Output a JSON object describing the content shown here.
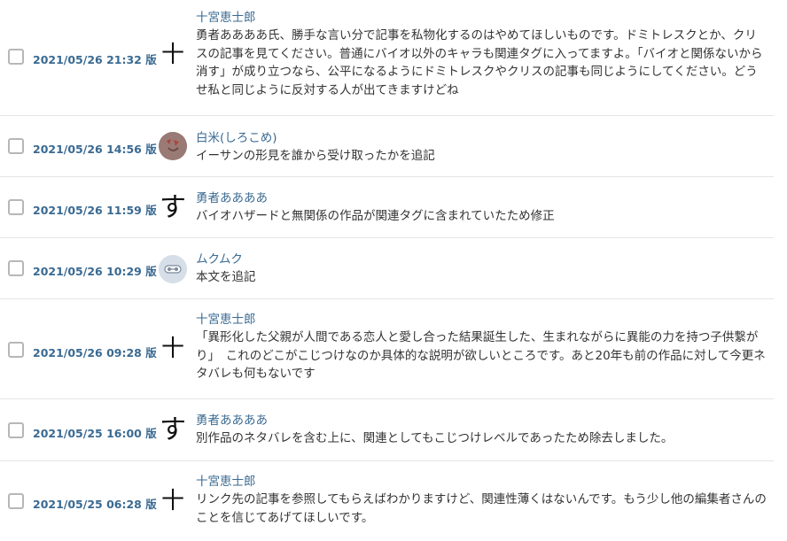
{
  "history": [
    {
      "version": "2021/05/26 21:32 版",
      "user": "十宮恵士郎",
      "avatar_icon": "ju-glyph-icon",
      "avatar_text": "十",
      "comment": "勇者ああああ氏、勝手な言い分で記事を私物化するのはやめてほしいものです。ドミトレスクとか、クリスの記事を見てください。普通にバイオ以外のキャラも関連タグに入ってますよ。「バイオと関係ないから消す」が成り立つなら、公平になるようにドミトレスクやクリスの記事も同じようにしてください。どうせ私と同じように反対する人が出てきますけどね"
    },
    {
      "version": "2021/05/26 14:56 版",
      "user": "白米(しろこめ)",
      "avatar_icon": "photo-avatar-icon",
      "avatar_text": "",
      "comment": "イーサンの形見を誰から受け取ったかを追記"
    },
    {
      "version": "2021/05/26 11:59 版",
      "user": "勇者ああああ",
      "avatar_icon": "su-glyph-icon",
      "avatar_text": "す",
      "comment": "バイオハザードと無関係の作品が関連タグに含まれていたため修正"
    },
    {
      "version": "2021/05/26 10:29 版",
      "user": "ムクムク",
      "avatar_icon": "robot-avatar-icon",
      "avatar_text": "",
      "comment": "本文を追記"
    },
    {
      "version": "2021/05/26 09:28 版",
      "user": "十宮恵士郎",
      "avatar_icon": "ju-glyph-icon",
      "avatar_text": "十",
      "comment": "「異形化した父親が人間である恋人と愛し合った結果誕生した、生まれながらに異能の力を持つ子供繋がり」　これのどこがこじつけなのか具体的な説明が欲しいところです。あと20年も前の作品に対して今更ネタバレも何もないです"
    },
    {
      "version": "2021/05/25 16:00 版",
      "user": "勇者ああああ",
      "avatar_icon": "su-glyph-icon",
      "avatar_text": "す",
      "comment": "別作品のネタバレを含む上に、関連としてもこじつけレベルであったため除去しました。"
    },
    {
      "version": "2021/05/25 06:28 版",
      "user": "十宮恵士郎",
      "avatar_icon": "ju-glyph-icon",
      "avatar_text": "十",
      "comment": "リンク先の記事を参照してもらえばわかりますけど、関連性薄くはないんです。もう少し他の編集者さんのことを信じてあげてほしいです。"
    }
  ]
}
